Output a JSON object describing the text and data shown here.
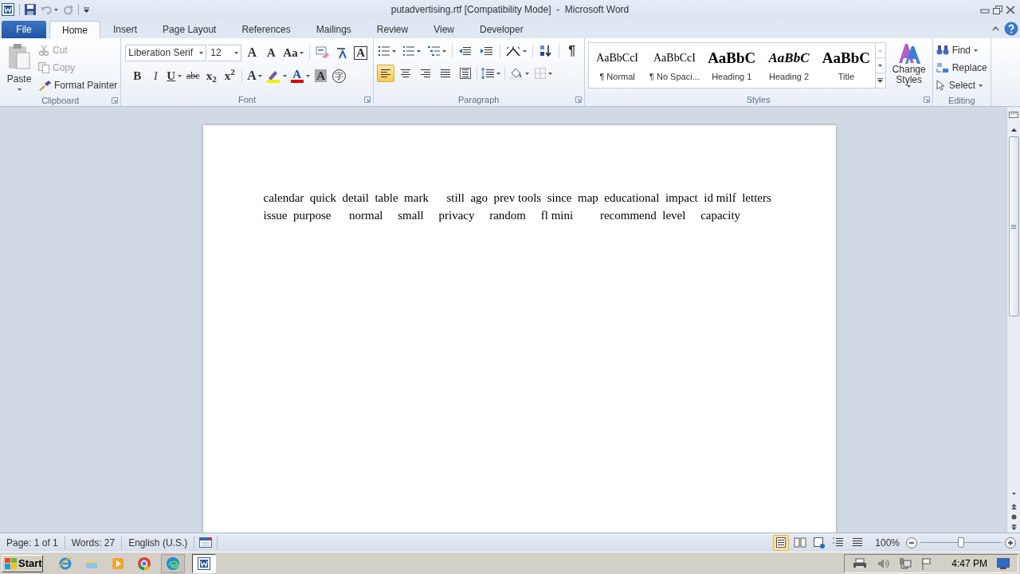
{
  "title_bar": {
    "title": "putadvertising.rtf [Compatibility Mode]  -  Microsoft Word"
  },
  "tabs": [
    {
      "label": "File",
      "kind": "file",
      "selected": false
    },
    {
      "label": "Home",
      "kind": "tab",
      "selected": true
    },
    {
      "label": "Insert",
      "kind": "tab",
      "selected": false
    },
    {
      "label": "Page Layout",
      "kind": "tab",
      "selected": false
    },
    {
      "label": "References",
      "kind": "tab",
      "selected": false
    },
    {
      "label": "Mailings",
      "kind": "tab",
      "selected": false
    },
    {
      "label": "Review",
      "kind": "tab",
      "selected": false
    },
    {
      "label": "View",
      "kind": "tab",
      "selected": false
    },
    {
      "label": "Developer",
      "kind": "tab",
      "selected": false
    }
  ],
  "clipboard": {
    "label": "Clipboard",
    "paste": "Paste",
    "items": [
      {
        "label": "Cut",
        "kind": "cut",
        "disabled": true
      },
      {
        "label": "Copy",
        "kind": "copy",
        "disabled": true
      },
      {
        "label": "Format Painter",
        "kind": "painter",
        "disabled": false
      }
    ]
  },
  "font": {
    "label": "Font",
    "font_name": "Liberation Serif",
    "font_size": "12",
    "row1": [
      {
        "kind": "grow",
        "label": "A"
      },
      {
        "kind": "shrink",
        "label": "A"
      },
      {
        "kind": "case",
        "label": "Aa"
      },
      {
        "kind": "clear"
      },
      {
        "kind": "phonetic"
      },
      {
        "kind": "border",
        "label": "A"
      }
    ],
    "row2": [
      {
        "kind": "bold",
        "label": "B"
      },
      {
        "kind": "italic",
        "label": "I"
      },
      {
        "kind": "underline",
        "label": "U"
      },
      {
        "kind": "strike",
        "label": "abc"
      },
      {
        "kind": "sub",
        "label": "x$_{2}$"
      },
      {
        "kind": "sup",
        "label": "x$^{2}$"
      },
      {
        "kind": "effects",
        "label": "A"
      },
      {
        "kind": "highlight"
      },
      {
        "kind": "color",
        "label": "A"
      },
      {
        "kind": "shading",
        "label": "A"
      },
      {
        "kind": "enclose",
        "label": "字"
      }
    ]
  },
  "paragraph": {
    "label": "Paragraph",
    "pilcrow": "¶",
    "align": [
      {
        "kind": "left",
        "selected": true
      },
      {
        "kind": "center",
        "selected": false
      },
      {
        "kind": "right",
        "selected": false
      },
      {
        "kind": "justify",
        "selected": false
      },
      {
        "kind": "distributed",
        "selected": false
      }
    ]
  },
  "styles": {
    "label": "Styles",
    "items": [
      {
        "preview": "AaBbCcI",
        "label": "¶ Normal",
        "kind": "normal"
      },
      {
        "preview": "AaBbCcI",
        "label": "¶ No Spaci...",
        "kind": "normal"
      },
      {
        "preview": "AaBbC",
        "label": "Heading 1",
        "kind": "heading1"
      },
      {
        "preview": "AaBbC",
        "label": "Heading 2",
        "kind": "heading2"
      },
      {
        "preview": "AaBbC",
        "label": "Title",
        "kind": "title"
      }
    ],
    "change_styles": "Change Styles"
  },
  "editing": {
    "label": "Editing",
    "items": [
      {
        "label": "Find",
        "kind": "find"
      },
      {
        "label": "Replace",
        "kind": "replace"
      },
      {
        "label": "Select",
        "kind": "select"
      }
    ]
  },
  "document": {
    "lines": [
      "calendar  quick  detail  table  mark      still  ago  prev tools  since  map  educational  impact  id milf  letters",
      "issue  purpose      normal     small     privacy     random     fl mini         recommend  level     capacity"
    ]
  },
  "status_bar": {
    "items": [
      "Page: 1 of 1",
      "Words: 27",
      "English (U.S.)"
    ],
    "views": [
      {
        "kind": "print",
        "selected": true
      },
      {
        "kind": "reading",
        "selected": false
      },
      {
        "kind": "web",
        "selected": false
      },
      {
        "kind": "outline",
        "selected": false
      },
      {
        "kind": "draft",
        "selected": false
      }
    ],
    "zoom": "100%",
    "zoom_level": {
      "level": 0.5
    }
  },
  "taskbar": {
    "start": "Start",
    "apps": [
      {
        "kind": "ie",
        "selected": false
      },
      {
        "kind": "folder",
        "selected": false
      },
      {
        "kind": "media",
        "selected": false
      },
      {
        "kind": "chrome",
        "selected": false
      },
      {
        "kind": "edge",
        "selected": false
      },
      {
        "kind": "word",
        "selected": true
      }
    ],
    "clock": "4:47 PM"
  }
}
